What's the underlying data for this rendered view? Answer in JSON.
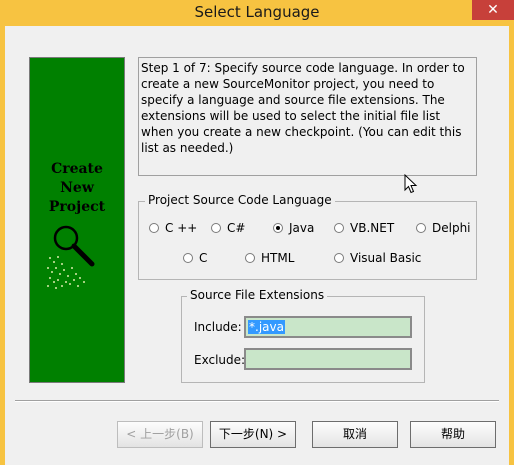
{
  "window": {
    "title": "Select Language",
    "close_glyph": "✕"
  },
  "wizard": {
    "image_lines": [
      "Create",
      "New",
      "Project"
    ],
    "image_icon": "magnifier-icon",
    "description": "Step 1 of 7: Specify source code language. In order to create a new SourceMonitor project, you need to specify a language and source file extensions. The extensions will be used to select the initial file list when you create a new checkpoint. (You can edit this list as needed.)"
  },
  "language_group": {
    "legend": "Project Source Code Language",
    "options": [
      "C ++",
      "C#",
      "Java",
      "VB.NET",
      "Delphi",
      "C",
      "HTML",
      "Visual Basic"
    ],
    "selected": "Java"
  },
  "extensions_group": {
    "legend": "Source File Extensions",
    "include_label": "Include:",
    "include_value": "*.java",
    "exclude_label": "Exclude:",
    "exclude_value": ""
  },
  "buttons": {
    "back": "< 上一步(B)",
    "next": "下一步(N) >",
    "cancel": "取消",
    "help": "帮助"
  },
  "colors": {
    "titlebar": "#f7c341",
    "close_button": "#c7403a",
    "wizard_panel": "#008000",
    "input_bg": "#c9e6c9",
    "selection": "#3399ff"
  }
}
